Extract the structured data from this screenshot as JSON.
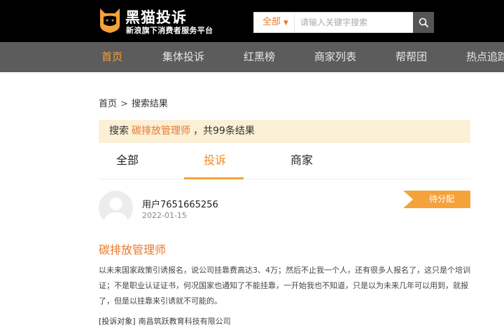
{
  "header": {
    "logo_title": "黑猫投诉",
    "logo_subtitle": "新浪旗下消费者服务平台",
    "search": {
      "category": "全部",
      "placeholder": "请输入关键字搜索"
    }
  },
  "nav": {
    "items": [
      {
        "label": "首页",
        "active": true
      },
      {
        "label": "集体投诉"
      },
      {
        "label": "红黑榜"
      },
      {
        "label": "商家列表"
      },
      {
        "label": "帮帮团"
      },
      {
        "label": "热点追踪"
      }
    ]
  },
  "breadcrumb": {
    "home": "首页",
    "separator": ">",
    "current": "搜索结果"
  },
  "results": {
    "prefix": "搜索",
    "keyword": "碳排放管理师",
    "suffix": "，共99条结果"
  },
  "tabs": [
    {
      "label": "全部"
    },
    {
      "label": "投诉",
      "active": true
    },
    {
      "label": "商家"
    }
  ],
  "complaint": {
    "username": "用户7651665256",
    "date": "2022-01-15",
    "status": "待分配",
    "title": "碳排放管理师",
    "body": "以未来国家政策引诱报名，说公司挂靠费高达3、4万；然后不止我一个人，还有很多人报名了，这只是个培训证；不是职业认证证书，何况国家也通知了不能挂靠，一开始我也不知道，只是以为未来几年可以用到，就报了，但是以挂靠来引诱就不可能的。",
    "target_label": "[投诉对象]",
    "target_value": "南昌筑跃教育科技有限公司"
  },
  "colors": {
    "accent": "#f5a23a",
    "link_orange": "#e8782a",
    "topbar": "#000000",
    "navbar": "#5c5c5c",
    "result_bg": "#fbefd6"
  }
}
